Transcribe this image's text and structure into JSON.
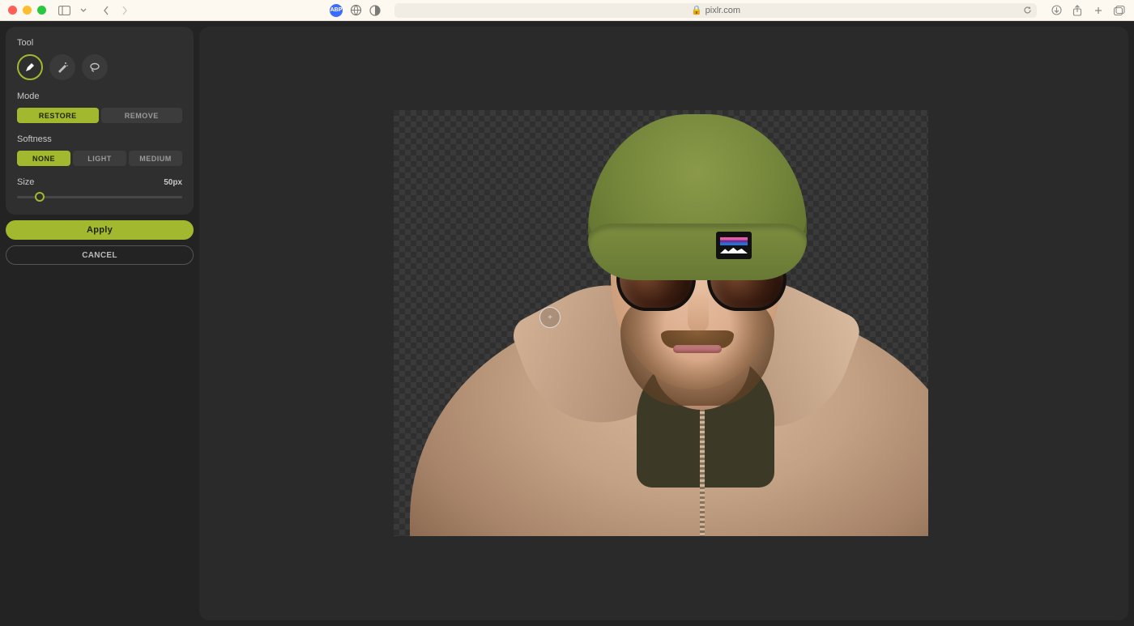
{
  "browser": {
    "url_host": "pixlr.com",
    "lock": "🔒"
  },
  "panel": {
    "tool_label": "Tool",
    "mode_label": "Mode",
    "mode_options": {
      "restore": "RESTORE",
      "remove": "REMOVE"
    },
    "softness_label": "Softness",
    "softness_options": {
      "none": "NONE",
      "light": "LIGHT",
      "medium": "MEDIUM"
    },
    "size_label": "Size",
    "size_value": "50px",
    "apply": "Apply",
    "cancel": "CANCEL"
  },
  "cursor": {
    "glyph": "+"
  }
}
